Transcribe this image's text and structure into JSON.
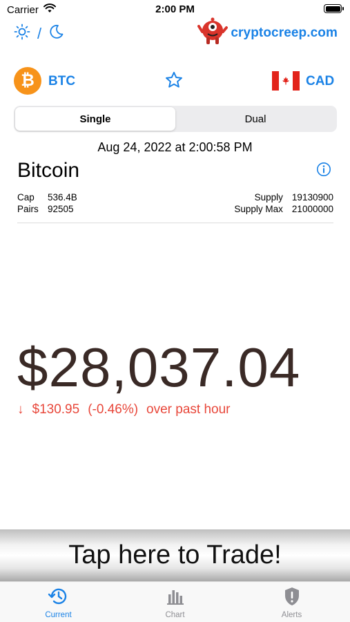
{
  "status_bar": {
    "carrier": "Carrier",
    "time": "2:00 PM"
  },
  "header": {
    "theme_separator": "/",
    "brand": "cryptocreep.com"
  },
  "coin_row": {
    "coin_symbol": "BTC",
    "coin_glyph": "₿",
    "currency": "CAD",
    "favorite_icon": "star-outline-icon"
  },
  "segment": {
    "options": [
      "Single",
      "Dual"
    ],
    "selected": "Single"
  },
  "timestamp": "Aug 24, 2022 at 2:00:58 PM",
  "coin": {
    "name": "Bitcoin",
    "stats_left": [
      {
        "label": "Cap",
        "value": "536.4B"
      },
      {
        "label": "Pairs",
        "value": "92505"
      }
    ],
    "stats_right": [
      {
        "label": "Supply",
        "value": "19130900"
      },
      {
        "label": "Supply Max",
        "value": "21000000"
      }
    ]
  },
  "price": {
    "value": "$28,037.04",
    "change_arrow": "↓",
    "change_amount": "$130.95",
    "change_percent": "(-0.46%)",
    "change_period": "over past hour"
  },
  "trade_banner": "Tap here to Trade!",
  "tabs": [
    {
      "label": "Current",
      "icon": "history-clock-icon",
      "active": true
    },
    {
      "label": "Chart",
      "icon": "bar-chart-icon",
      "active": false
    },
    {
      "label": "Alerts",
      "icon": "shield-alert-icon",
      "active": false
    }
  ],
  "colors": {
    "accent": "#1a82e6",
    "bitcoin_orange": "#f7931a",
    "price_text": "#3a2a26",
    "negative": "#e8473a",
    "canada_red": "#e2231a"
  }
}
